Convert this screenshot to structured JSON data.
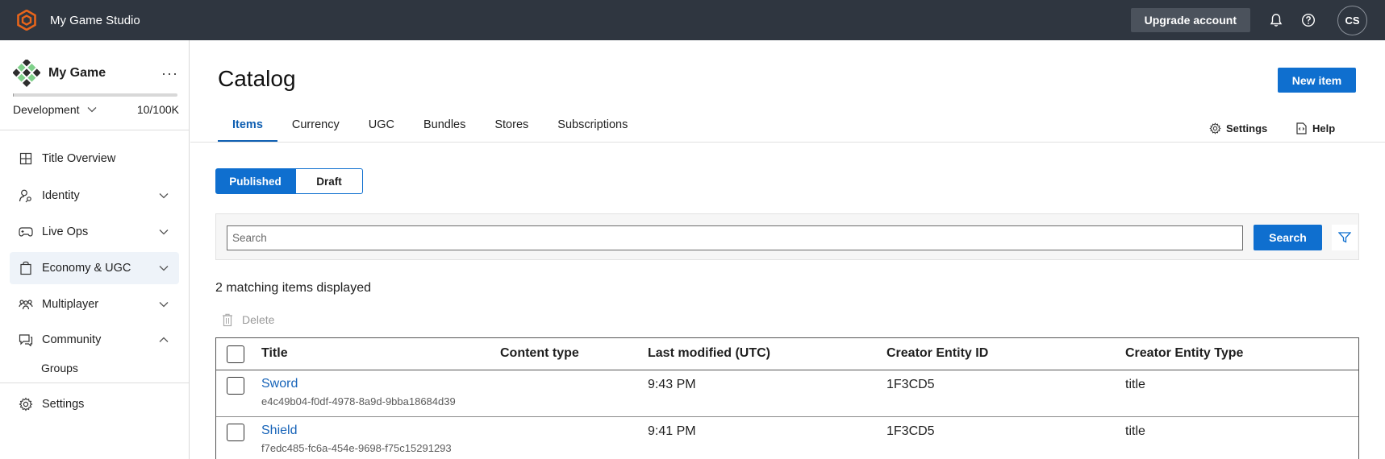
{
  "topbar": {
    "studio_name": "My Game Studio",
    "upgrade_label": "Upgrade account",
    "avatar_initials": "CS",
    "brand_color": "#e8651b"
  },
  "sidebar": {
    "game_name": "My Game",
    "more_label": "···",
    "environment": "Development",
    "usage": "10/100K",
    "usage_fraction": 0.0001,
    "items": [
      {
        "label": "Title Overview",
        "icon": "grid-icon",
        "chevron": "none"
      },
      {
        "label": "Identity",
        "icon": "identity-icon",
        "chevron": "down"
      },
      {
        "label": "Live Ops",
        "icon": "gamepad-icon",
        "chevron": "down"
      },
      {
        "label": "Economy & UGC",
        "icon": "bag-icon",
        "chevron": "down",
        "active": true
      },
      {
        "label": "Multiplayer",
        "icon": "people-icon",
        "chevron": "down"
      },
      {
        "label": "Community",
        "icon": "community-icon",
        "chevron": "up"
      }
    ],
    "sub_items": [
      {
        "label": "Groups"
      }
    ],
    "settings_label": "Settings"
  },
  "main": {
    "title": "Catalog",
    "new_item_label": "New item",
    "tabs": [
      {
        "label": "Items",
        "active": true
      },
      {
        "label": "Currency"
      },
      {
        "label": "UGC"
      },
      {
        "label": "Bundles"
      },
      {
        "label": "Stores"
      },
      {
        "label": "Subscriptions"
      }
    ],
    "settings_label": "Settings",
    "help_label": "Help",
    "toggle": {
      "published": "Published",
      "draft": "Draft"
    },
    "search": {
      "placeholder": "Search",
      "button": "Search"
    },
    "result_count": "2 matching items displayed",
    "delete_label": "Delete",
    "table": {
      "columns": [
        "Title",
        "Content type",
        "Last modified (UTC)",
        "Creator Entity ID",
        "Creator Entity Type"
      ],
      "rows": [
        {
          "title": "Sword",
          "id": "e4c49b04-f0df-4978-8a9d-9bba18684d39",
          "content_type": "",
          "modified": "9:43 PM",
          "creator_id": "1F3CD5",
          "creator_type": "title"
        },
        {
          "title": "Shield",
          "id": "f7edc485-fc6a-454e-9698-f75c15291293",
          "content_type": "",
          "modified": "9:41 PM",
          "creator_id": "1F3CD5",
          "creator_type": "title"
        }
      ]
    }
  },
  "colors": {
    "accent": "#0f6fcf",
    "topbar": "#2f3640",
    "link": "#1663b8"
  }
}
